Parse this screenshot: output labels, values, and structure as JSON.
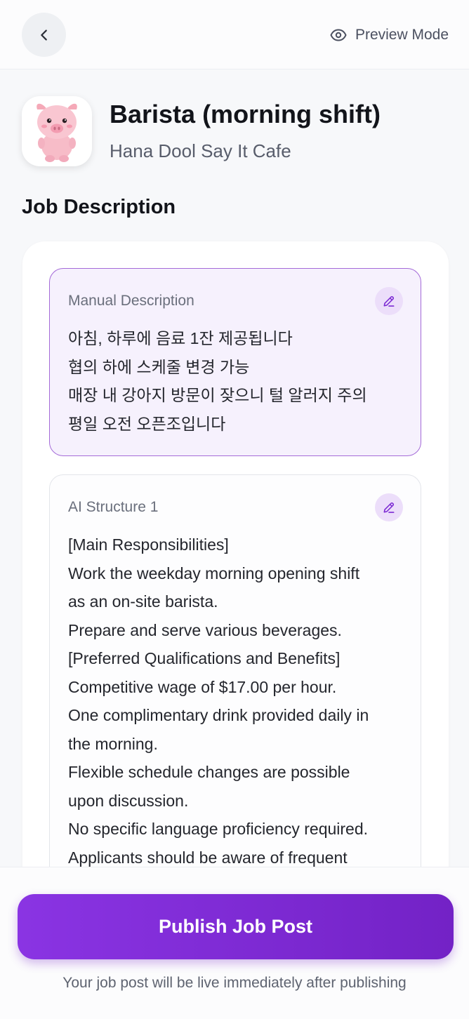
{
  "topbar": {
    "back_icon": "chevron-left-icon",
    "preview_icon": "eye-icon",
    "preview_label": "Preview Mode"
  },
  "job": {
    "avatar_icon": "pig-mascot-icon",
    "title": "Barista (morning shift)",
    "company": "Hana Dool Say It Cafe"
  },
  "section": {
    "title": "Job Description"
  },
  "manual": {
    "label": "Manual Description",
    "edit_icon": "pencil-icon",
    "lines": [
      "아침, 하루에 음료 1잔 제공됩니다",
      "협의 하에 스케줄 변경 가능",
      "매장 내 강아지 방문이 잦으니 털 알러지 주의",
      "평일 오전 오픈조입니다"
    ]
  },
  "ai": {
    "label": "AI Structure 1",
    "edit_icon": "pencil-icon",
    "lines": [
      "[Main Responsibilities]",
      "Work the weekday morning opening shift",
      "as an on-site barista.",
      "Prepare and serve various beverages.",
      "[Preferred Qualifications and Benefits]",
      "Competitive wage of $17.00 per hour.",
      "One complimentary drink provided daily in",
      "the morning.",
      "Flexible schedule changes are possible",
      "upon discussion.",
      "No specific language proficiency required.",
      "Applicants should be aware of frequent"
    ]
  },
  "footer": {
    "publish_label": "Publish Job Post",
    "note": "Your job post will be live immediately after publishing"
  },
  "colors": {
    "accent": "#7d2bd4",
    "accent_light": "#f6f1fd",
    "accent_border": "#a46ad8"
  }
}
